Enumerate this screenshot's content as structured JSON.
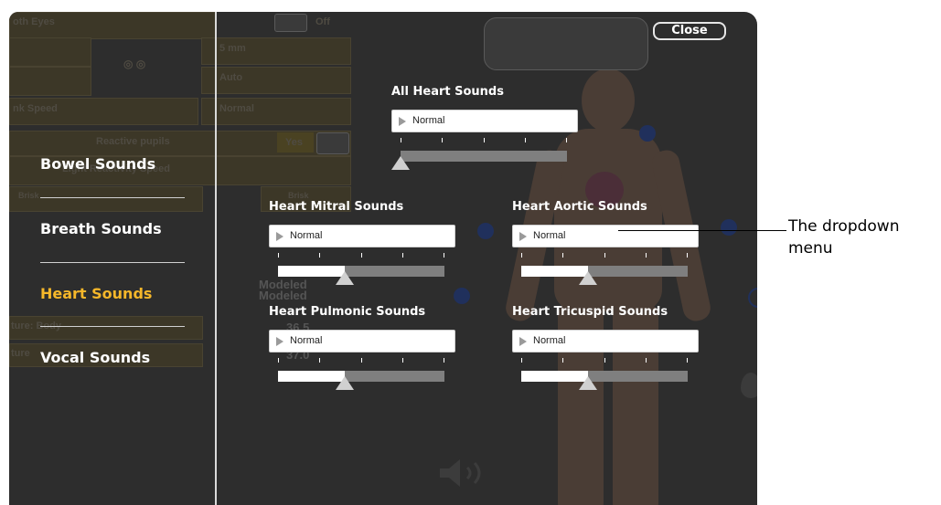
{
  "background_panel": {
    "labels": [
      "oth Eyes",
      "Off",
      "5 mm",
      "Auto",
      "nk Speed",
      "Normal",
      "Reactive pupils",
      "Yes",
      "Light Reactivity Speed",
      "Brisk",
      "Brisk",
      "Modeled",
      "Modeled",
      "ture: Body",
      "36.5",
      "ture",
      "37.0"
    ]
  },
  "sidebar": {
    "items": [
      {
        "label": "Bowel Sounds",
        "active": false
      },
      {
        "label": "Breath Sounds",
        "active": false
      },
      {
        "label": "Heart Sounds",
        "active": true
      },
      {
        "label": "Vocal Sounds",
        "active": false
      }
    ],
    "active_color": "#f5b72a"
  },
  "dialog": {
    "close_label": "Close"
  },
  "heart_sounds": [
    {
      "label": "All Heart Sounds",
      "value": "Normal",
      "level": 0.0
    },
    {
      "label": "Heart Mitral Sounds",
      "value": "Normal",
      "level": 0.4
    },
    {
      "label": "Heart Aortic Sounds",
      "value": "Normal",
      "level": 0.4
    },
    {
      "label": "Heart Pulmonic Sounds",
      "value": "Normal",
      "level": 0.4
    },
    {
      "label": "Heart Tricuspid Sounds",
      "value": "Normal",
      "level": 0.4
    }
  ],
  "annotation": {
    "text": "The dropdown menu"
  }
}
